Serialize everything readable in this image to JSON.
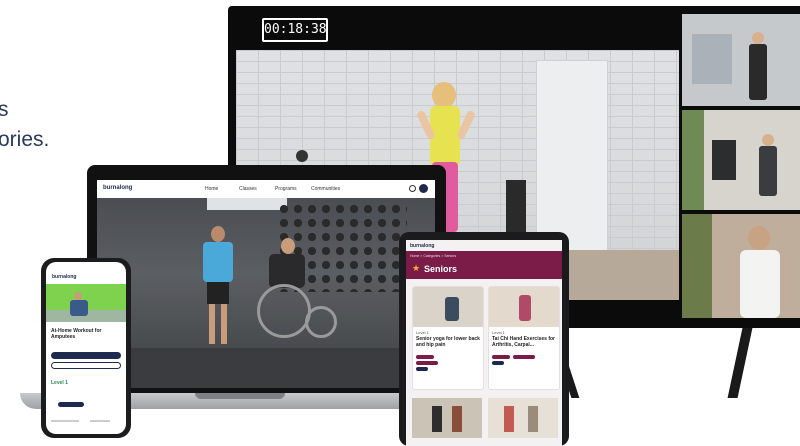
{
  "hero": {
    "text_line1": "s",
    "text_line2": "ories."
  },
  "tv": {
    "timer": "00:18:38"
  },
  "laptop": {
    "brand": "burnalong",
    "nav": [
      "Home",
      "Classes",
      "Programs",
      "Communities"
    ]
  },
  "tablet": {
    "brand": "burnalong",
    "breadcrumb": "Home > Categories > Seniors",
    "page_title": "Seniors",
    "cards": [
      {
        "title": "Senior yoga for lower back and hip pain",
        "level": "Level 1"
      },
      {
        "title": "Tai Chi Hand Exercises for Arthritis, Carpal...",
        "level": "Level 1"
      }
    ]
  },
  "phone": {
    "brand": "burnalong",
    "workout_title": "At-Home Workout for Amputees",
    "level": "Level 1"
  },
  "colors": {
    "accent": "#7a1c47",
    "primary": "#1d2a4d",
    "text": "#2b3a5a"
  }
}
